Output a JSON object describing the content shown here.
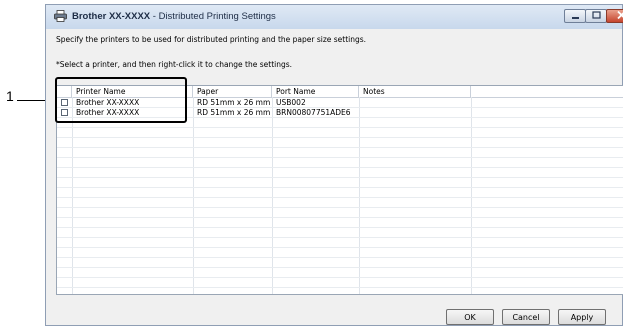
{
  "callout": {
    "number": "1"
  },
  "window": {
    "title_bold": "Brother XX-XXXX",
    "title_rest": " - Distributed Printing Settings",
    "description": "Specify the printers to be used for distributed printing and the paper size settings.",
    "instruction": "*Select a printer, and then right-click it to change the settings."
  },
  "table": {
    "columns": [
      "Printer Name",
      "Paper",
      "Port Name",
      "Notes"
    ],
    "rows": [
      {
        "printer": "Brother XX-XXXX",
        "paper": "RD 51mm x 26 mm",
        "port": "USB002",
        "notes": "",
        "checked": false
      },
      {
        "printer": "Brother XX-XXXX",
        "paper": "RD 51mm x 26 mm",
        "port": "BRN00807751ADE6",
        "notes": "",
        "checked": false
      }
    ]
  },
  "buttons": {
    "ok": "OK",
    "cancel": "Cancel",
    "apply": "Apply"
  },
  "icons": {
    "app": "printer-icon",
    "minimize": "minimize-icon",
    "maximize": "maximize-icon",
    "close": "close-icon"
  },
  "colors": {
    "titlebar": "#c8d8ec",
    "close_button": "#c5452e"
  }
}
